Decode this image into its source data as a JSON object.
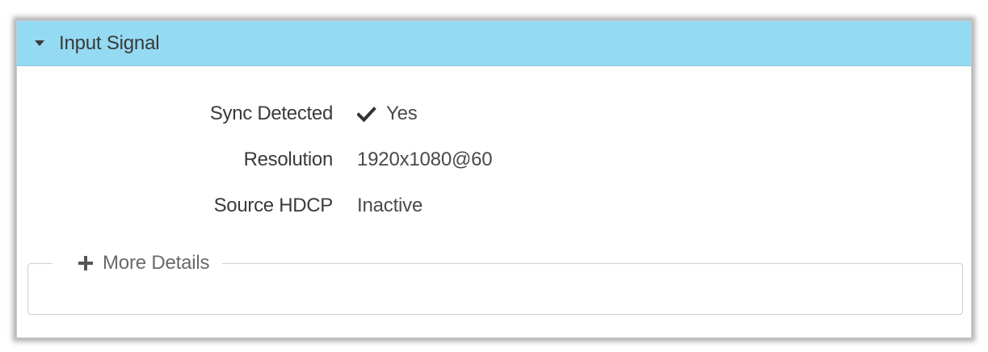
{
  "panel": {
    "title": "Input Signal",
    "toggle_icon": "caret-down-icon"
  },
  "fields": [
    {
      "label": "Sync Detected",
      "value": "Yes",
      "icon": "checkmark-icon"
    },
    {
      "label": "Resolution",
      "value": "1920x1080@60"
    },
    {
      "label": "Source HDCP",
      "value": "Inactive"
    }
  ],
  "details": {
    "label": "More Details",
    "icon": "plus-icon"
  },
  "colors": {
    "header_bg": "#94daf2",
    "text": "#3a3a3a",
    "muted": "#6a6a6a"
  }
}
